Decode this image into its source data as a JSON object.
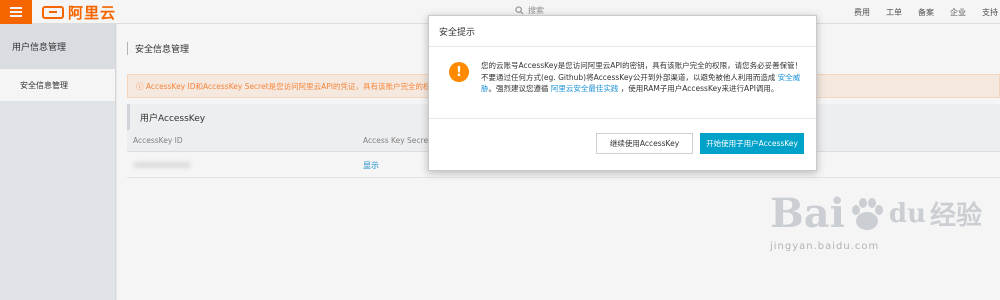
{
  "header": {
    "brand": "阿里云",
    "search_placeholder": "搜索",
    "links": [
      "费用",
      "工单",
      "备案",
      "企业",
      "支持"
    ]
  },
  "sidebar": {
    "title": "用户信息管理",
    "items": [
      {
        "label": "安全信息管理"
      }
    ]
  },
  "main": {
    "page_title": "安全信息管理",
    "notice": "ⓘ AccessKey ID和AccessKey Secret是您访问阿里云API的凭证，具有该账户完全的权",
    "section_title": "用户AccessKey",
    "table": {
      "columns": [
        "AccessKey ID",
        "Access Key Secret"
      ],
      "rows": [
        {
          "id": "",
          "secret_action": "显示"
        }
      ]
    }
  },
  "dialog": {
    "title": "安全提示",
    "message_part1": "您的云账号AccessKey是您访问阿里云API的密钥，具有该账户完全的权限，请您务必妥善保管！不要通过任何方式(eg. Github)将AccessKey公开到外部渠道，以避免被他人利用而造成",
    "message_link1": "安全威胁",
    "message_part2": "。强烈建议您遵循",
    "message_link2": "阿里云安全最佳实践",
    "message_part3": "，使用RAM子用户AccessKey来进行API调用。",
    "btn_continue": "继续使用AccessKey",
    "btn_primary": "开始使用子用户AccessKey"
  },
  "watermark": {
    "brand": "Bai",
    "brand2": "du",
    "cn": "经验",
    "url": "jingyan.baidu.com"
  },
  "colors": {
    "accent": "#ff6a00",
    "primary_button": "#00a2ca",
    "link": "#1890d5",
    "warning": "#ff8a00"
  }
}
